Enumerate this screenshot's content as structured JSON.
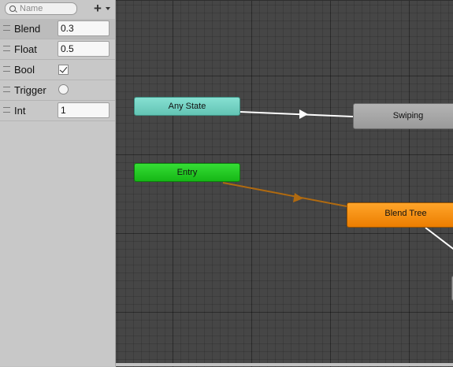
{
  "parameters_panel": {
    "search": {
      "placeholder": "Name",
      "value": ""
    },
    "add_button": {
      "symbol": "+"
    },
    "rows": [
      {
        "name": "Blend",
        "type": "float",
        "value": "0.3"
      },
      {
        "name": "Float",
        "type": "float",
        "value": "0.5"
      },
      {
        "name": "Bool",
        "type": "bool",
        "checked": true
      },
      {
        "name": "Trigger",
        "type": "trigger",
        "set": false
      },
      {
        "name": "Int",
        "type": "int",
        "value": "1"
      }
    ]
  },
  "graph": {
    "nodes": {
      "any_state": {
        "label": "Any State",
        "color": "#6fcfbf"
      },
      "entry": {
        "label": "Entry",
        "color": "#22c522"
      },
      "swiping": {
        "label": "Swiping",
        "color": "#a8a8a8"
      },
      "blend_tree": {
        "label": "Blend Tree",
        "color": "#f58a0c"
      }
    },
    "transitions": [
      {
        "from": "Any State",
        "to": "Swiping",
        "color": "#ffffff"
      },
      {
        "from": "Entry",
        "to": "Blend Tree",
        "color": "#b06a10"
      },
      {
        "from": "Blend Tree",
        "to": "",
        "color": "#ffffff"
      }
    ]
  }
}
